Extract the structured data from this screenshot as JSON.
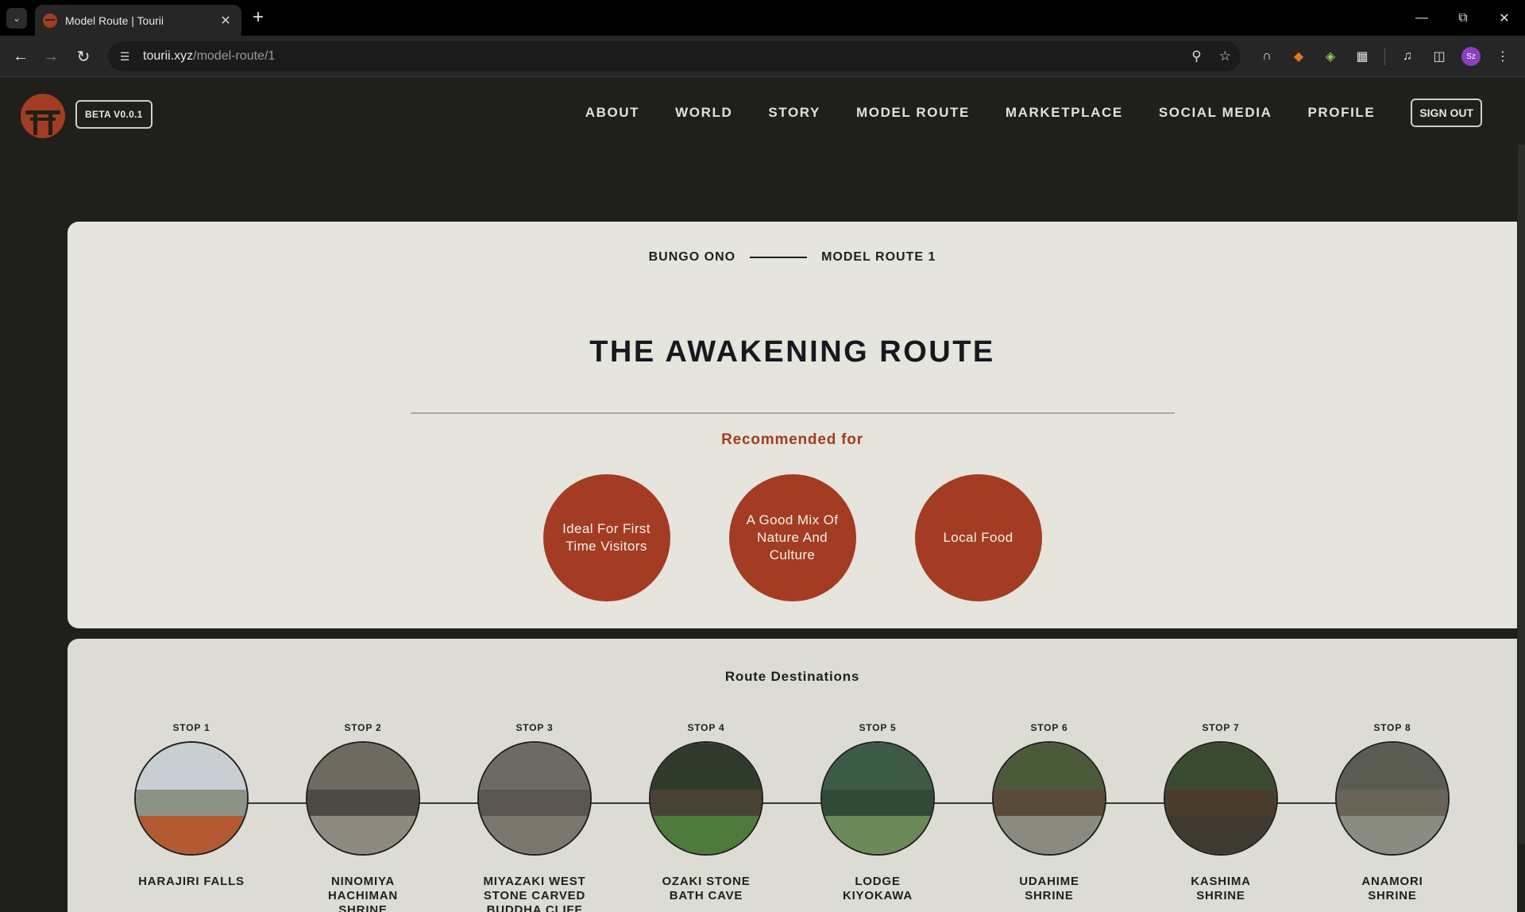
{
  "browser": {
    "tab_title": "Model Route | Tourii",
    "url_host": "tourii.xyz",
    "url_path": "/model-route/1",
    "profile_initials": "Sz"
  },
  "site": {
    "beta_label": "BETA V0.0.1",
    "nav": [
      "ABOUT",
      "WORLD",
      "STORY",
      "MODEL ROUTE",
      "MARKETPLACE",
      "SOCIAL MEDIA",
      "PROFILE"
    ],
    "sign_out_label": "SIGN OUT",
    "brand_color": "#a33c22"
  },
  "hero": {
    "crumb_region": "BUNGO ONO",
    "crumb_route": "MODEL ROUTE 1",
    "title": "THE AWAKENING ROUTE",
    "recommended_heading": "Recommended for",
    "recommended": [
      "Ideal For First Time Visitors",
      "A Good Mix Of Nature And Culture",
      "Local Food"
    ]
  },
  "destinations": {
    "heading": "Route Destinations",
    "stops": [
      {
        "label": "STOP 1",
        "name": "HARAJIRI FALLS"
      },
      {
        "label": "STOP 2",
        "name": "NINOMIYA HACHIMAN SHRINE"
      },
      {
        "label": "STOP 3",
        "name": "MIYAZAKI WEST STONE CARVED BUDDHA CLIFF"
      },
      {
        "label": "STOP 4",
        "name": "OZAKI STONE BATH CAVE"
      },
      {
        "label": "STOP 5",
        "name": "LODGE KIYOKAWA"
      },
      {
        "label": "STOP 6",
        "name": "UDAHIME SHRINE"
      },
      {
        "label": "STOP 7",
        "name": "KASHIMA SHRINE"
      },
      {
        "label": "STOP 8",
        "name": "ANAMORI SHRINE"
      }
    ]
  },
  "icons": {
    "tab_dropdown": "chevron-down-icon",
    "close_tab": "close-icon",
    "new_tab": "plus-icon",
    "back": "arrow-left-icon",
    "forward": "arrow-right-icon",
    "reload": "reload-icon",
    "site_info": "tune-icon",
    "password": "key-icon",
    "bookmark": "star-icon"
  }
}
